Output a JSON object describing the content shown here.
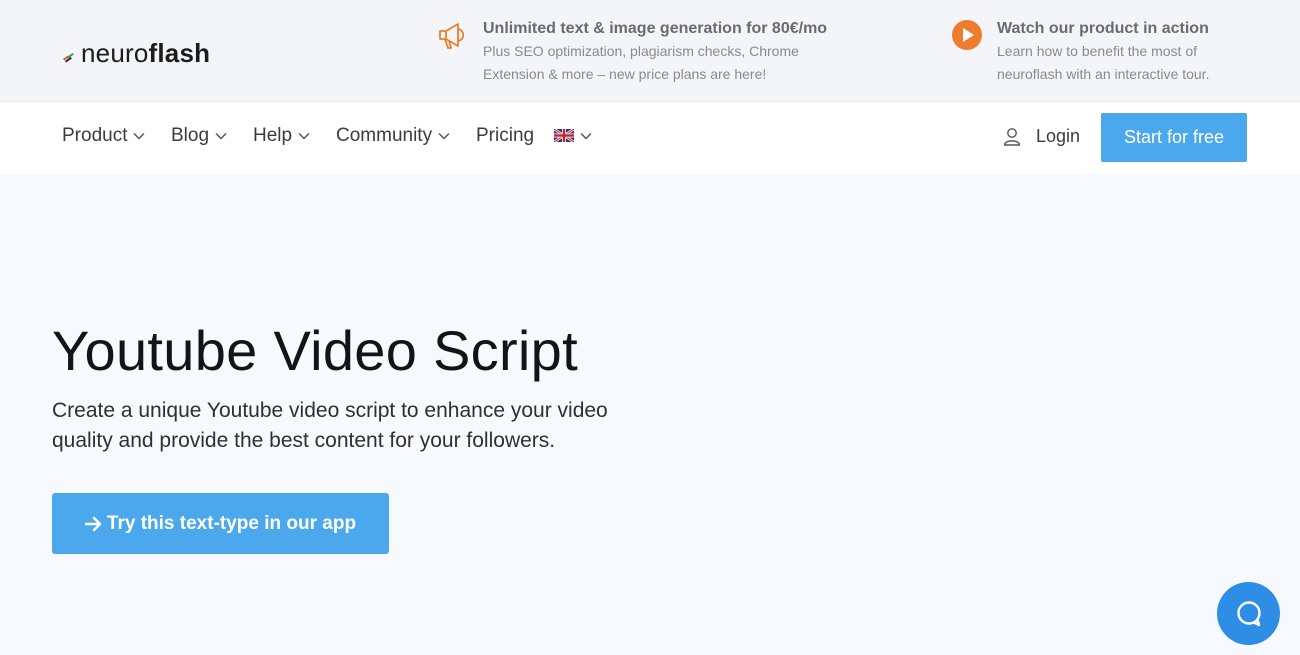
{
  "logo": {
    "text_light": "neuro",
    "text_bold": "flash"
  },
  "promos": [
    {
      "icon": "megaphone-icon",
      "title": "Unlimited text & image generation for 80€/mo",
      "lines": [
        "Plus SEO optimization, plagiarism checks, Chrome",
        "Extension & more – new price plans are here!"
      ]
    },
    {
      "icon": "play-circle-icon",
      "title": "Watch our product in action",
      "lines": [
        "Learn how to benefit the most of",
        "neuroflash with an interactive tour."
      ]
    }
  ],
  "nav": {
    "items": [
      {
        "label": "Product",
        "dropdown": true
      },
      {
        "label": "Blog",
        "dropdown": true
      },
      {
        "label": "Help",
        "dropdown": true
      },
      {
        "label": "Community",
        "dropdown": true
      },
      {
        "label": "Pricing",
        "dropdown": false
      }
    ],
    "language_icon": "uk-flag-icon",
    "login_label": "Login",
    "start_label": "Start for free"
  },
  "hero": {
    "title": "Youtube Video Script",
    "description_lines": [
      "Create a unique Youtube video script to enhance your video",
      "quality and provide the best content for your followers."
    ],
    "cta_label": "Try this text-type in our app"
  },
  "colors": {
    "accent": "#4ba8ec",
    "promo_icon": "#ee7d2e",
    "chat": "#2e8ee6"
  },
  "chat_icon": "chat-bubble-icon"
}
